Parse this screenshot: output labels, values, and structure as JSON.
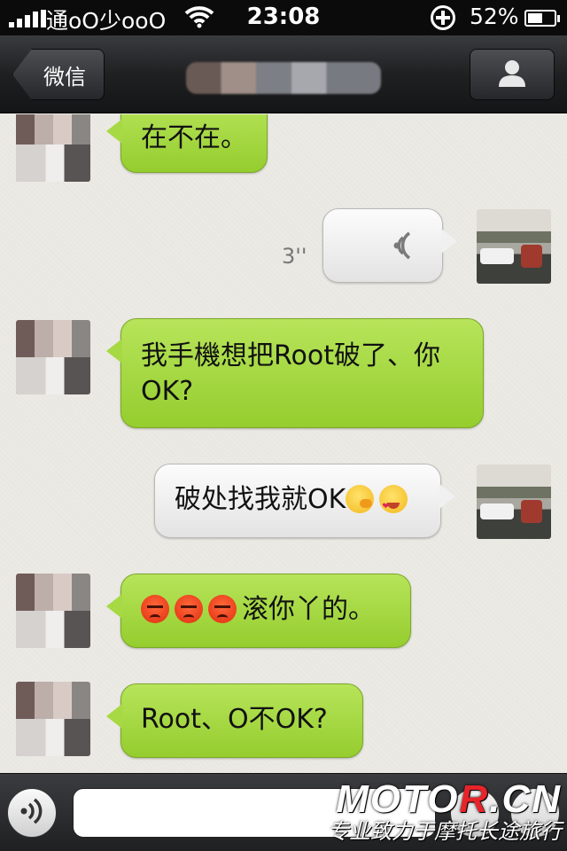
{
  "status_bar": {
    "carrier": "通oO少ooO",
    "time": "23:08",
    "battery_percent": "52%",
    "battery_level": 0.52,
    "icons": [
      "signal-icon",
      "wifi-icon",
      "rotation-lock-icon",
      "battery-icon"
    ]
  },
  "nav": {
    "back_label": "微信",
    "title": "",
    "profile_icon": "person-icon"
  },
  "messages": [
    {
      "sender": "friend",
      "type": "text",
      "text": "在不在。"
    },
    {
      "sender": "me",
      "type": "voice",
      "duration": "3''"
    },
    {
      "sender": "friend",
      "type": "text",
      "line1": "我手機想把Root破了、你",
      "line2": "OK?"
    },
    {
      "sender": "me",
      "type": "text",
      "text": "破处找我就OK",
      "emojis": [
        "thinking-face-icon",
        "heart-eyes-face-icon"
      ]
    },
    {
      "sender": "friend",
      "type": "text",
      "emojis": [
        "angry-face-icon",
        "angry-face-icon",
        "angry-face-icon"
      ],
      "text": "滚你丫的。"
    },
    {
      "sender": "friend",
      "type": "text",
      "text": "Root、O不OK?"
    }
  ],
  "input_bar": {
    "placeholder": "",
    "voice_icon": "voice-wave-icon",
    "emoji_icon": "emoji-icon",
    "plus_icon": "plus-icon"
  },
  "watermark": {
    "logo_prefix": "MOTO",
    "logo_accent": "R",
    "logo_suffix": ".CN",
    "tagline": "专业致力于摩托长途旅行"
  },
  "colors": {
    "incoming_bubble": "#a6d944",
    "outgoing_bubble": "#f0f0f0",
    "nav_bar": "#1f2022",
    "chat_background": "#eceae4"
  }
}
